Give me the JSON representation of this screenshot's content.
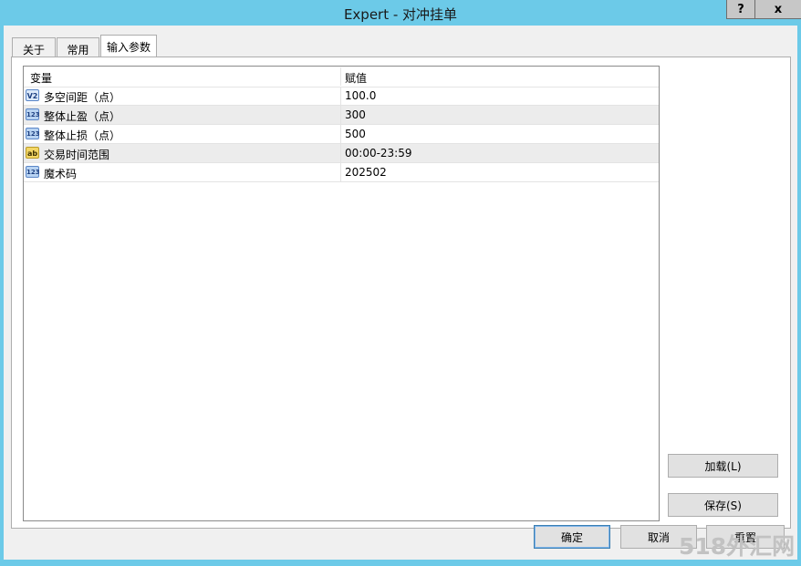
{
  "window": {
    "title": "Expert - 对冲挂单",
    "help_button": "?",
    "close_button": "x"
  },
  "tabs": [
    {
      "label": "关于"
    },
    {
      "label": "常用"
    },
    {
      "label": "输入参数"
    }
  ],
  "grid": {
    "headers": {
      "variable": "变量",
      "value": "赋值"
    },
    "rows": [
      {
        "icon": "V2",
        "icon_name": "double-type-icon",
        "variable": "多空间距（点）",
        "value": "100.0"
      },
      {
        "icon": "123",
        "icon_name": "integer-type-icon",
        "variable": "整体止盈（点）",
        "value": "300"
      },
      {
        "icon": "123",
        "icon_name": "integer-type-icon",
        "variable": "整体止损（点）",
        "value": "500"
      },
      {
        "icon": "ab",
        "icon_name": "string-type-icon",
        "variable": "交易时间范围",
        "value": "00:00-23:59"
      },
      {
        "icon": "123",
        "icon_name": "integer-type-icon",
        "variable": "魔术码",
        "value": "202502"
      }
    ]
  },
  "buttons": {
    "load": "加载(L)",
    "save": "保存(S)",
    "ok": "确定",
    "cancel": "取消",
    "reset": "重置"
  },
  "watermark": "518外汇网",
  "colors": {
    "titlebar": "#6ccae8",
    "window_bg": "#f0f0f0",
    "alt_row": "#ececec"
  }
}
